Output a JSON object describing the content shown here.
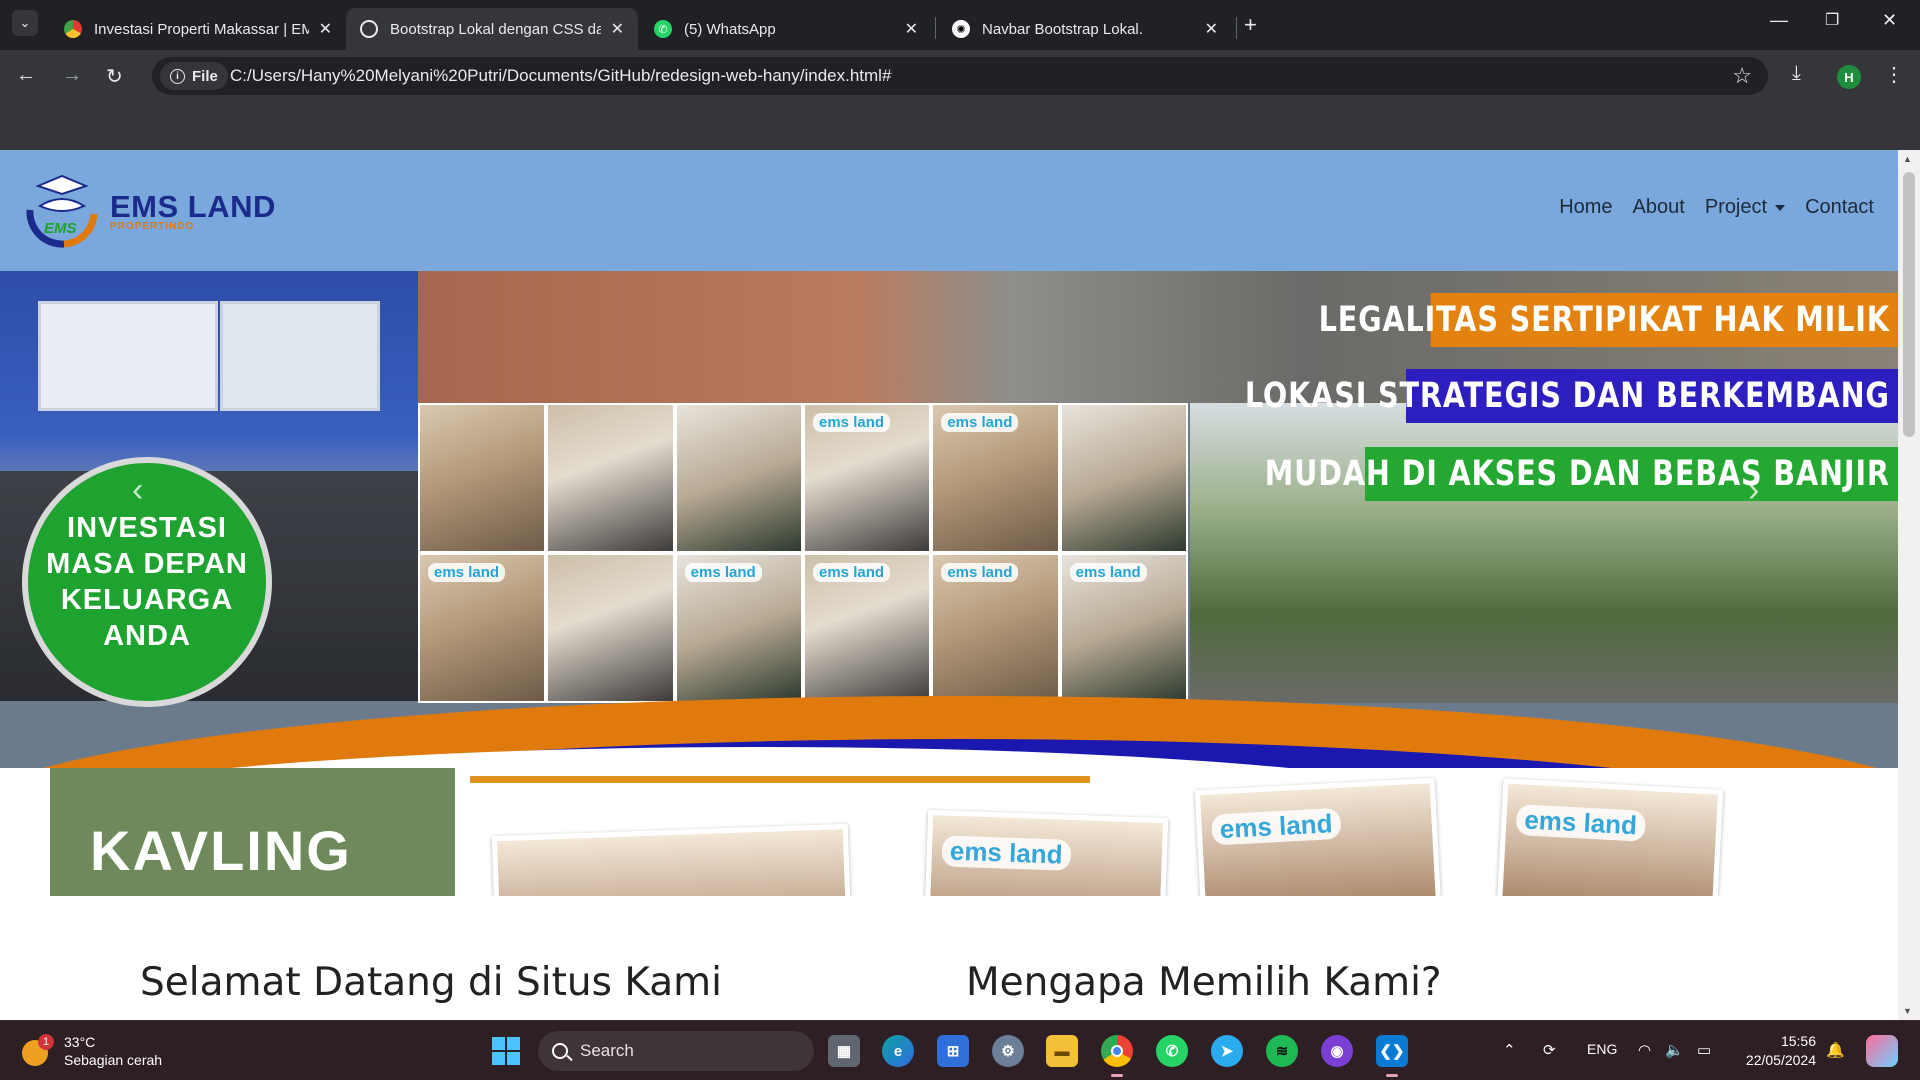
{
  "browser": {
    "tabs": [
      {
        "title": "Investasi Properti Makassar | EMS",
        "active": false,
        "icon": "ems-favicon"
      },
      {
        "title": "Bootstrap Lokal dengan CSS da",
        "active": true,
        "icon": "globe-icon"
      },
      {
        "title": "(5) WhatsApp",
        "active": false,
        "icon": "whatsapp-icon"
      },
      {
        "title": "Navbar Bootstrap Lokal.",
        "active": false,
        "icon": "chatgpt-icon"
      }
    ],
    "new_tab": "+",
    "omnibox": {
      "chip_label": "File",
      "url": "C:/Users/Hany%20Melyani%20Putri/Documents/GitHub/redesign-web-hany/index.html#"
    },
    "profile_initial": "H"
  },
  "site": {
    "brand": {
      "name": "EMS LAND",
      "sub": "PROPERTINDO",
      "logo_text": "EMS"
    },
    "nav": {
      "home": "Home",
      "about": "About",
      "project": "Project",
      "contact": "Contact"
    },
    "hero": {
      "badge_lines": [
        "INVESTASI",
        "MASA DEPAN",
        "KELUARGA",
        "ANDA"
      ],
      "ribbons": [
        "LEGALITAS SERTIPIKAT HAK MILIK",
        "LOKASI STRATEGIS DAN BERKEMBANG",
        "MUDAH DI AKSES DAN BEBAS BANJIR"
      ],
      "photo_tag": "ems land",
      "prev": "‹",
      "next": "›"
    },
    "banner2": {
      "kavling": "KAVLING",
      "card_tag": "ems land"
    },
    "headings": {
      "welcome": "Selamat Datang di Situs Kami",
      "why": "Mengapa Memilih Kami?"
    }
  },
  "taskbar": {
    "weather": {
      "temp": "33°C",
      "desc": "Sebagian cerah",
      "alerts": "1"
    },
    "search_placeholder": "Search",
    "apps": [
      "task-view",
      "edge",
      "store",
      "settings",
      "file-explorer",
      "chrome",
      "whatsapp",
      "telegram",
      "spotify",
      "github-desktop",
      "vscode"
    ],
    "tray": {
      "lang": "ENG"
    },
    "clock": {
      "time": "15:56",
      "date": "22/05/2024"
    }
  }
}
